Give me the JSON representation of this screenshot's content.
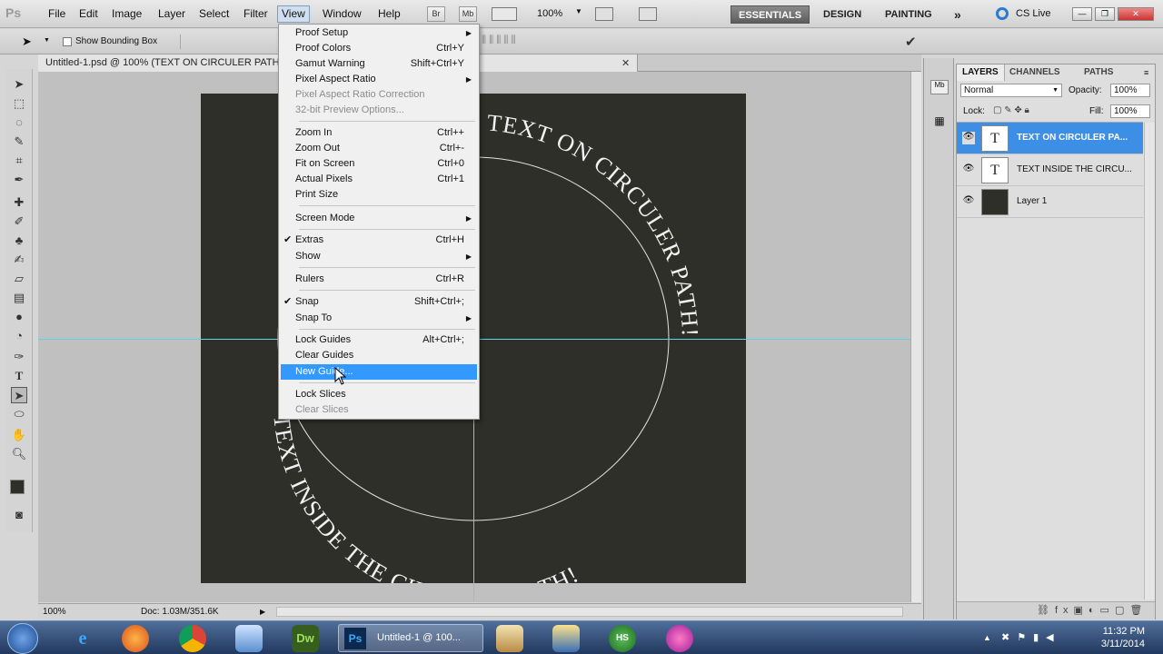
{
  "menubar": {
    "logo": "Ps",
    "items": [
      "File",
      "Edit",
      "Image",
      "Layer",
      "Select",
      "Filter",
      "View",
      "Window",
      "Help"
    ],
    "bridge": "Br",
    "minibridge": "Mb",
    "zoom": "100%",
    "workspaces": [
      "ESSENTIALS",
      "DESIGN",
      "PAINTING"
    ],
    "more": "»",
    "cslive": "CS Live"
  },
  "options": {
    "show_bounding_box": "Show Bounding Box"
  },
  "document": {
    "tab_title": "Untitled-1.psd @ 100% (TEXT ON CIRCULER PATH!, RGB/8) *",
    "text_top": "TEXT ON CIRCULER PATH!",
    "text_bottom": "TEXT INSIDE THE CIRCULER PATH!",
    "status_zoom": "100%",
    "status_doc": "Doc: 1.03M/351.6K"
  },
  "view_menu": {
    "items": [
      {
        "label": "Proof Setup",
        "shortcut": "",
        "submenu": true
      },
      {
        "label": "Proof Colors",
        "shortcut": "Ctrl+Y"
      },
      {
        "label": "Gamut Warning",
        "shortcut": "Shift+Ctrl+Y"
      },
      {
        "label": "Pixel Aspect Ratio",
        "shortcut": "",
        "submenu": true
      },
      {
        "label": "Pixel Aspect Ratio Correction",
        "shortcut": "",
        "disabled": true
      },
      {
        "label": "32-bit Preview Options...",
        "shortcut": "",
        "disabled": true
      },
      {
        "label": "Zoom In",
        "shortcut": "Ctrl++"
      },
      {
        "label": "Zoom Out",
        "shortcut": "Ctrl+-"
      },
      {
        "label": "Fit on Screen",
        "shortcut": "Ctrl+0"
      },
      {
        "label": "Actual Pixels",
        "shortcut": "Ctrl+1"
      },
      {
        "label": "Print Size",
        "shortcut": ""
      },
      {
        "label": "Screen Mode",
        "shortcut": "",
        "submenu": true
      },
      {
        "label": "Extras",
        "shortcut": "Ctrl+H",
        "checked": true
      },
      {
        "label": "Show",
        "shortcut": "",
        "submenu": true
      },
      {
        "label": "Rulers",
        "shortcut": "Ctrl+R"
      },
      {
        "label": "Snap",
        "shortcut": "Shift+Ctrl+;",
        "checked": true
      },
      {
        "label": "Snap To",
        "shortcut": "",
        "submenu": true
      },
      {
        "label": "Lock Guides",
        "shortcut": "Alt+Ctrl+;"
      },
      {
        "label": "Clear Guides",
        "shortcut": ""
      },
      {
        "label": "New Guide...",
        "shortcut": "",
        "highlighted": true
      },
      {
        "label": "Lock Slices",
        "shortcut": ""
      },
      {
        "label": "Clear Slices",
        "shortcut": "",
        "disabled": true
      }
    ]
  },
  "layers_panel": {
    "tabs": [
      "LAYERS",
      "CHANNELS",
      "PATHS"
    ],
    "blend_mode": "Normal",
    "opacity_label": "Opacity:",
    "opacity": "100%",
    "lock_label": "Lock:",
    "fill_label": "Fill:",
    "fill": "100%",
    "layers": [
      {
        "name": "TEXT ON CIRCULER PA...",
        "selected": true,
        "type": "T"
      },
      {
        "name": "TEXT INSIDE THE CIRCU...",
        "selected": false,
        "type": "T"
      },
      {
        "name": "Layer 1",
        "selected": false,
        "type": ""
      }
    ]
  },
  "taskbar": {
    "ps_window": "Untitled-1 @ 100...",
    "dw": "Dw",
    "ps": "Ps",
    "hs": "HS",
    "time": "11:32 PM",
    "date": "3/11/2014"
  },
  "colors": {
    "selection": "#3399ff",
    "canvas": "#2f2f2a",
    "guide": "#5fd3e6"
  }
}
